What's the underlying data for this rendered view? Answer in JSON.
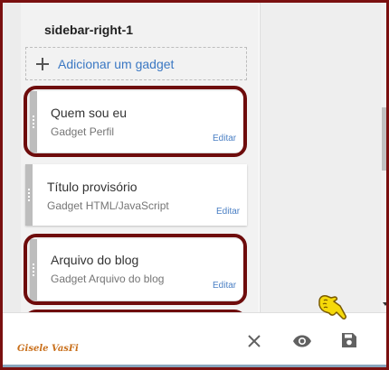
{
  "sidebar": {
    "section_title": "sidebar-right-1",
    "add_gadget_label": "Adicionar um gadget"
  },
  "gadgets": [
    {
      "title": "Quem sou eu",
      "subtitle": "Gadget Perfil",
      "edit_label": "Editar",
      "highlighted": true
    },
    {
      "title": "Título provisório",
      "subtitle": "Gadget HTML/JavaScript",
      "edit_label": "Editar",
      "highlighted": false
    },
    {
      "title": "Arquivo do blog",
      "subtitle": "Gadget Arquivo do blog",
      "edit_label": "Editar",
      "highlighted": true
    }
  ],
  "bottom_bar": {
    "close_icon": "close-icon",
    "preview_icon": "eye-icon",
    "save_icon": "save-icon",
    "pointer_icon": "pointing-hand-icon"
  },
  "watermark": "Gisele VasFi",
  "colors": {
    "highlight": "#6e0c0c",
    "frame": "#7a1010",
    "link": "#3b78c3",
    "pointer": "#f5d90a",
    "signature": "#c9701c"
  }
}
